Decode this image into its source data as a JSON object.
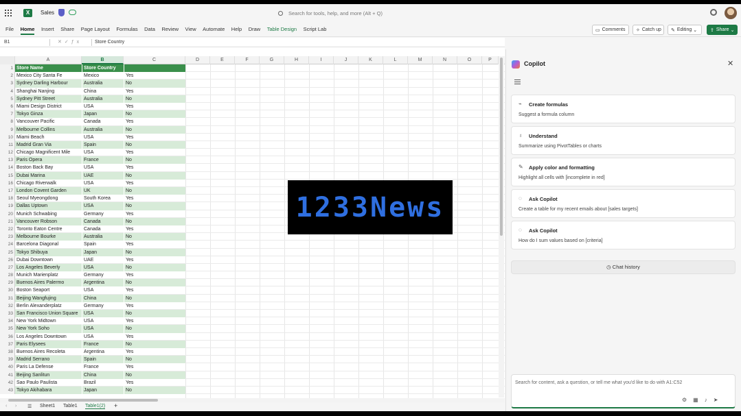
{
  "titlebar": {
    "title": "Sales",
    "search_placeholder": "Search for tools, help, and more (Alt + Q)"
  },
  "ribbon": {
    "tabs": [
      "File",
      "Home",
      "Insert",
      "Share",
      "Page Layout",
      "Formulas",
      "Data",
      "Review",
      "View",
      "Automate",
      "Help",
      "Draw",
      "Table Design",
      "Script Lab"
    ],
    "comments": "Comments",
    "catch_up": "Catch up",
    "editing": "Editing",
    "share": "Share"
  },
  "formula_bar": {
    "name_box": "B1",
    "value": "Store Country"
  },
  "columns": [
    "A",
    "B",
    "C",
    "D",
    "E",
    "F",
    "G",
    "H",
    "I",
    "J",
    "K",
    "L",
    "M",
    "N",
    "O",
    "P"
  ],
  "table": {
    "headers": [
      "Store Name",
      "Store Country",
      ""
    ],
    "rows": [
      [
        "Mexico City Santa Fe",
        "Mexico",
        "Yes"
      ],
      [
        "Sydney Darling Harbour",
        "Australia",
        "No"
      ],
      [
        "Shanghai Nanjing",
        "China",
        "Yes"
      ],
      [
        "Sydney Pitt Street",
        "Australia",
        "No"
      ],
      [
        "Miami Design District",
        "USA",
        "Yes"
      ],
      [
        "Tokyo Ginza",
        "Japan",
        "No"
      ],
      [
        "Vancouver Pacific",
        "Canada",
        "Yes"
      ],
      [
        "Melbourne Collins",
        "Australia",
        "No"
      ],
      [
        "Miami Beach",
        "USA",
        "Yes"
      ],
      [
        "Madrid Gran Via",
        "Spain",
        "No"
      ],
      [
        "Chicago Magnificent Mile",
        "USA",
        "Yes"
      ],
      [
        "Paris Opera",
        "France",
        "No"
      ],
      [
        "Boston Back Bay",
        "USA",
        "Yes"
      ],
      [
        "Dubai Marina",
        "UAE",
        "No"
      ],
      [
        "Chicago Riverwalk",
        "USA",
        "Yes"
      ],
      [
        "London Covent Garden",
        "UK",
        "No"
      ],
      [
        "Seoul Myeongdong",
        "South Korea",
        "Yes"
      ],
      [
        "Dallas Uptown",
        "USA",
        "No"
      ],
      [
        "Munich Schwabing",
        "Germany",
        "Yes"
      ],
      [
        "Vancouver Robson",
        "Canada",
        "No"
      ],
      [
        "Toronto Eaton Centre",
        "Canada",
        "Yes"
      ],
      [
        "Melbourne Bourke",
        "Australia",
        "No"
      ],
      [
        "Barcelona Diagonal",
        "Spain",
        "Yes"
      ],
      [
        "Tokyo Shibuya",
        "Japan",
        "No"
      ],
      [
        "Dubai Downtown",
        "UAE",
        "Yes"
      ],
      [
        "Los Angeles Beverly",
        "USA",
        "No"
      ],
      [
        "Munich Marienplatz",
        "Germany",
        "Yes"
      ],
      [
        "Buenos Aires Palermo",
        "Argentina",
        "No"
      ],
      [
        "Boston Seaport",
        "USA",
        "Yes"
      ],
      [
        "Beijing Wangfujing",
        "China",
        "No"
      ],
      [
        "Berlin Alexanderplatz",
        "Germany",
        "Yes"
      ],
      [
        "San Francisco Union Square",
        "USA",
        "No"
      ],
      [
        "New York Midtown",
        "USA",
        "Yes"
      ],
      [
        "New York Soho",
        "USA",
        "No"
      ],
      [
        "Los Angeles Downtown",
        "USA",
        "Yes"
      ],
      [
        "Paris Elysees",
        "France",
        "No"
      ],
      [
        "Buenos Aires Recoleta",
        "Argentina",
        "Yes"
      ],
      [
        "Madrid Serrano",
        "Spain",
        "No"
      ],
      [
        "Paris La Defense",
        "France",
        "Yes"
      ],
      [
        "Beijing Sanlitun",
        "China",
        "No"
      ],
      [
        "Sao Paulo Paulista",
        "Brazil",
        "Yes"
      ],
      [
        "Tokyo Akihabara",
        "Japan",
        "No"
      ]
    ]
  },
  "sheet_tabs": [
    "Sheet1",
    "Table1",
    "Table1(2)"
  ],
  "copilot": {
    "title": "Copilot",
    "cards": [
      {
        "title": "Create formulas",
        "desc": "Suggest a formula column",
        "icon": "formula-icon"
      },
      {
        "title": "Understand",
        "desc": "Summarize using PivotTables or charts",
        "icon": "lightbulb-icon"
      },
      {
        "title": "Apply color and formatting",
        "desc": "Highlight all cells with [incomplete in red]",
        "icon": "brush-icon"
      },
      {
        "title": "Ask Copilot",
        "desc": "Create a table for my recent emails about [sales targets]",
        "icon": "chat-icon"
      },
      {
        "title": "Ask Copilot",
        "desc": "How do I sum values based on [criteria]",
        "icon": "chat-icon"
      }
    ],
    "chat_history": "Chat history",
    "input_placeholder": "Search for content, ask a question, or tell me what you'd like to do with A1:C52"
  },
  "watermark": "1233News",
  "colors": {
    "accent": "#1d7a45",
    "table_header": "#3a8f4b",
    "band": "#d7ebd8",
    "watermark_text": "#2f6fe0"
  }
}
